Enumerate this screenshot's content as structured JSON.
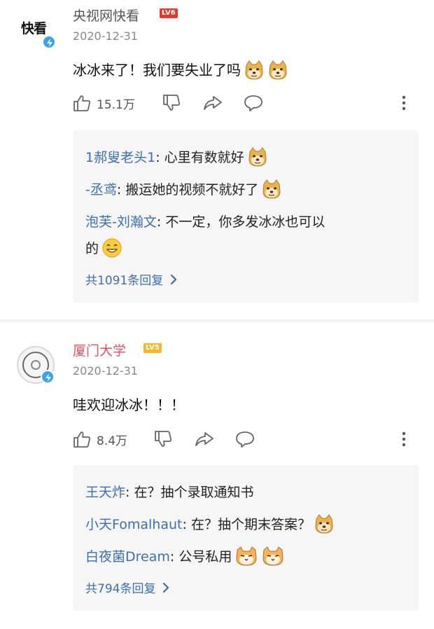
{
  "comments": [
    {
      "avatar_text": "快看",
      "name": "央视网快看",
      "level": "LV6",
      "date": "2020-12-31",
      "text": "冰冰来了！我们要失业了吗",
      "likes": "15.1万",
      "replies": [
        {
          "user": "1郝叟老头1",
          "sep": ": ",
          "text": "心里有数就好"
        },
        {
          "user": "-丞鸢",
          "sep": ": ",
          "text": "搬运她的视频不就好了"
        },
        {
          "user": "泡芙-刘瀚文",
          "sep": ": ",
          "text": "不一定，你多发冰冰也可以",
          "text2": "的"
        }
      ],
      "more_replies": "共1091条回复"
    },
    {
      "name": "厦门大学",
      "level": "LV5",
      "date": "2020-12-31",
      "text": "哇欢迎冰冰！！！",
      "likes": "8.4万",
      "replies": [
        {
          "user": "王天炸",
          "sep": ": ",
          "text": "在？抽个录取通知书"
        },
        {
          "user": "小天Fomalhaut",
          "sep": ": ",
          "text": "在？抽个期末答案？"
        },
        {
          "user": "白夜菌Dream",
          "sep": ": ",
          "text": "公号私用"
        }
      ],
      "more_replies": "共794条回复"
    }
  ],
  "colors": {
    "username_link": "#3b6fb3",
    "brand_red": "#e05060",
    "lv6": "#e33a2e",
    "lv5": "#f4b72b"
  },
  "icons": [
    "thumbs-up-icon",
    "thumbs-down-icon",
    "share-icon",
    "reply-bubble-icon",
    "more-vertical-icon",
    "doge-emoji-icon",
    "smile-emoji-icon",
    "cat-emoji-icon",
    "chevron-right-icon",
    "verified-icon"
  ]
}
